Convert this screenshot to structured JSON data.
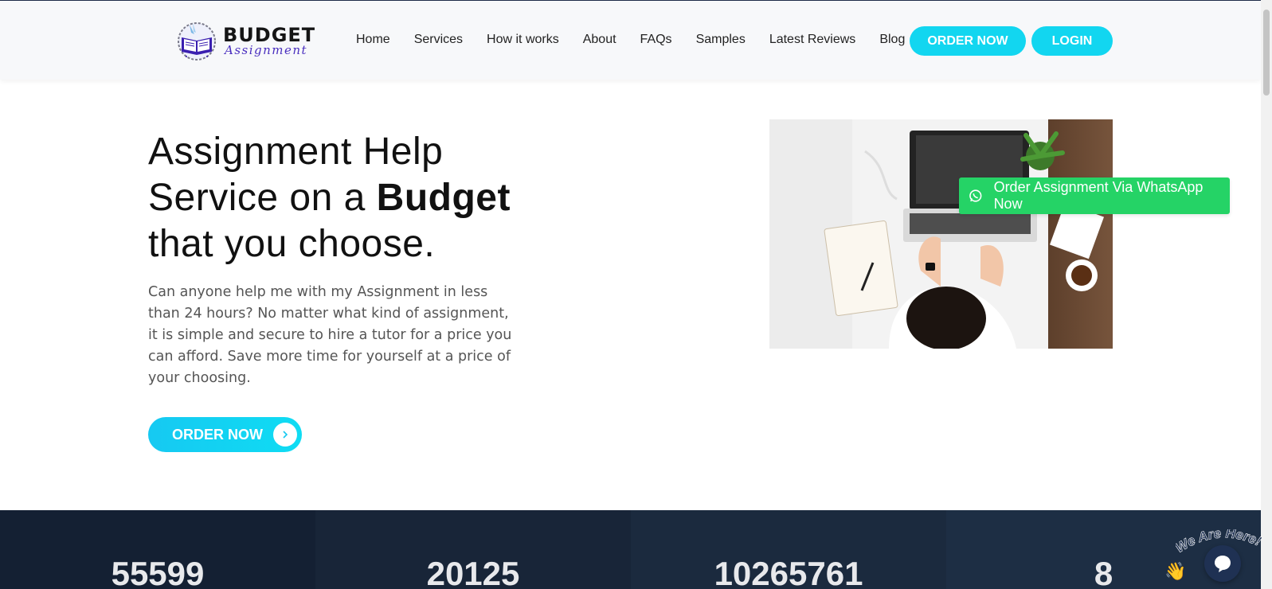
{
  "header": {
    "logo_main": "BUDGET",
    "logo_sub": "Assignment",
    "nav": [
      "Home",
      "Services",
      "How it works",
      "About",
      "FAQs",
      "Samples",
      "Latest Reviews",
      "Blog"
    ],
    "order_button": "ORDER NOW",
    "login_button": "LOGIN"
  },
  "hero": {
    "title_line1": "Assignment Help",
    "title_line2_pre": "Service on a ",
    "title_line2_bold": "Budget",
    "title_line3": "that you choose.",
    "description": "Can anyone help me with my Assignment in less than 24 hours? No matter what kind of assignment, it is simple and secure to hire a tutor for a price you can afford. Save more time for yourself at a price of your choosing.",
    "order_button": "ORDER NOW"
  },
  "whatsapp": {
    "label": "Order Assignment Via WhatsApp Now"
  },
  "stats": [
    "55599",
    "20125",
    "10265761",
    "8"
  ],
  "chat": {
    "label": "We Are Here!"
  },
  "colors": {
    "accent": "#12d6f0",
    "whatsapp": "#25d366",
    "stats_bg": "#152236",
    "logo_purple": "#4a2fbf"
  }
}
